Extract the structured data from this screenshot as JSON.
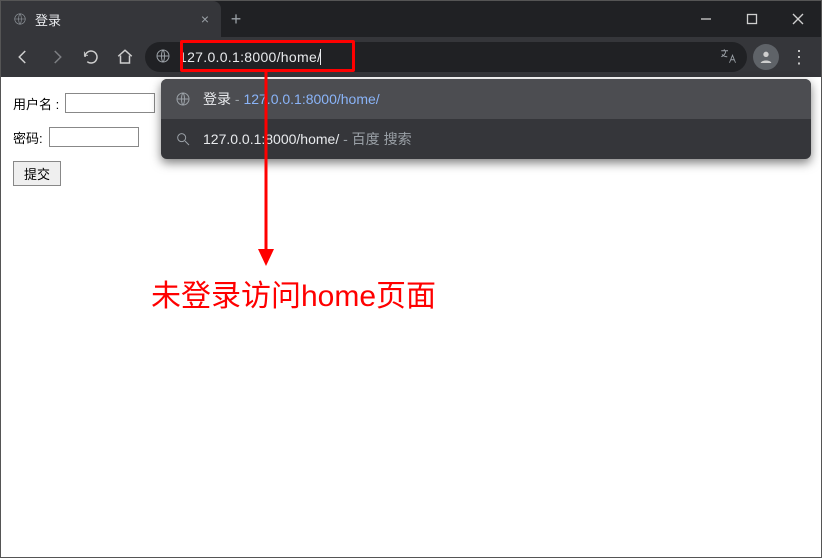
{
  "tab": {
    "title": "登录"
  },
  "url": "127.0.0.1:8000/home/",
  "suggestions": [
    {
      "prefix": "登录",
      "sep": " - ",
      "link": "127.0.0.1:8000/home/"
    },
    {
      "main": "127.0.0.1:8000/home/",
      "suffix": " - 百度 搜索"
    }
  ],
  "form": {
    "username_label": "用户名 :",
    "password_label": "密码:",
    "submit_label": "提交"
  },
  "annotation": "未登录访问home页面"
}
